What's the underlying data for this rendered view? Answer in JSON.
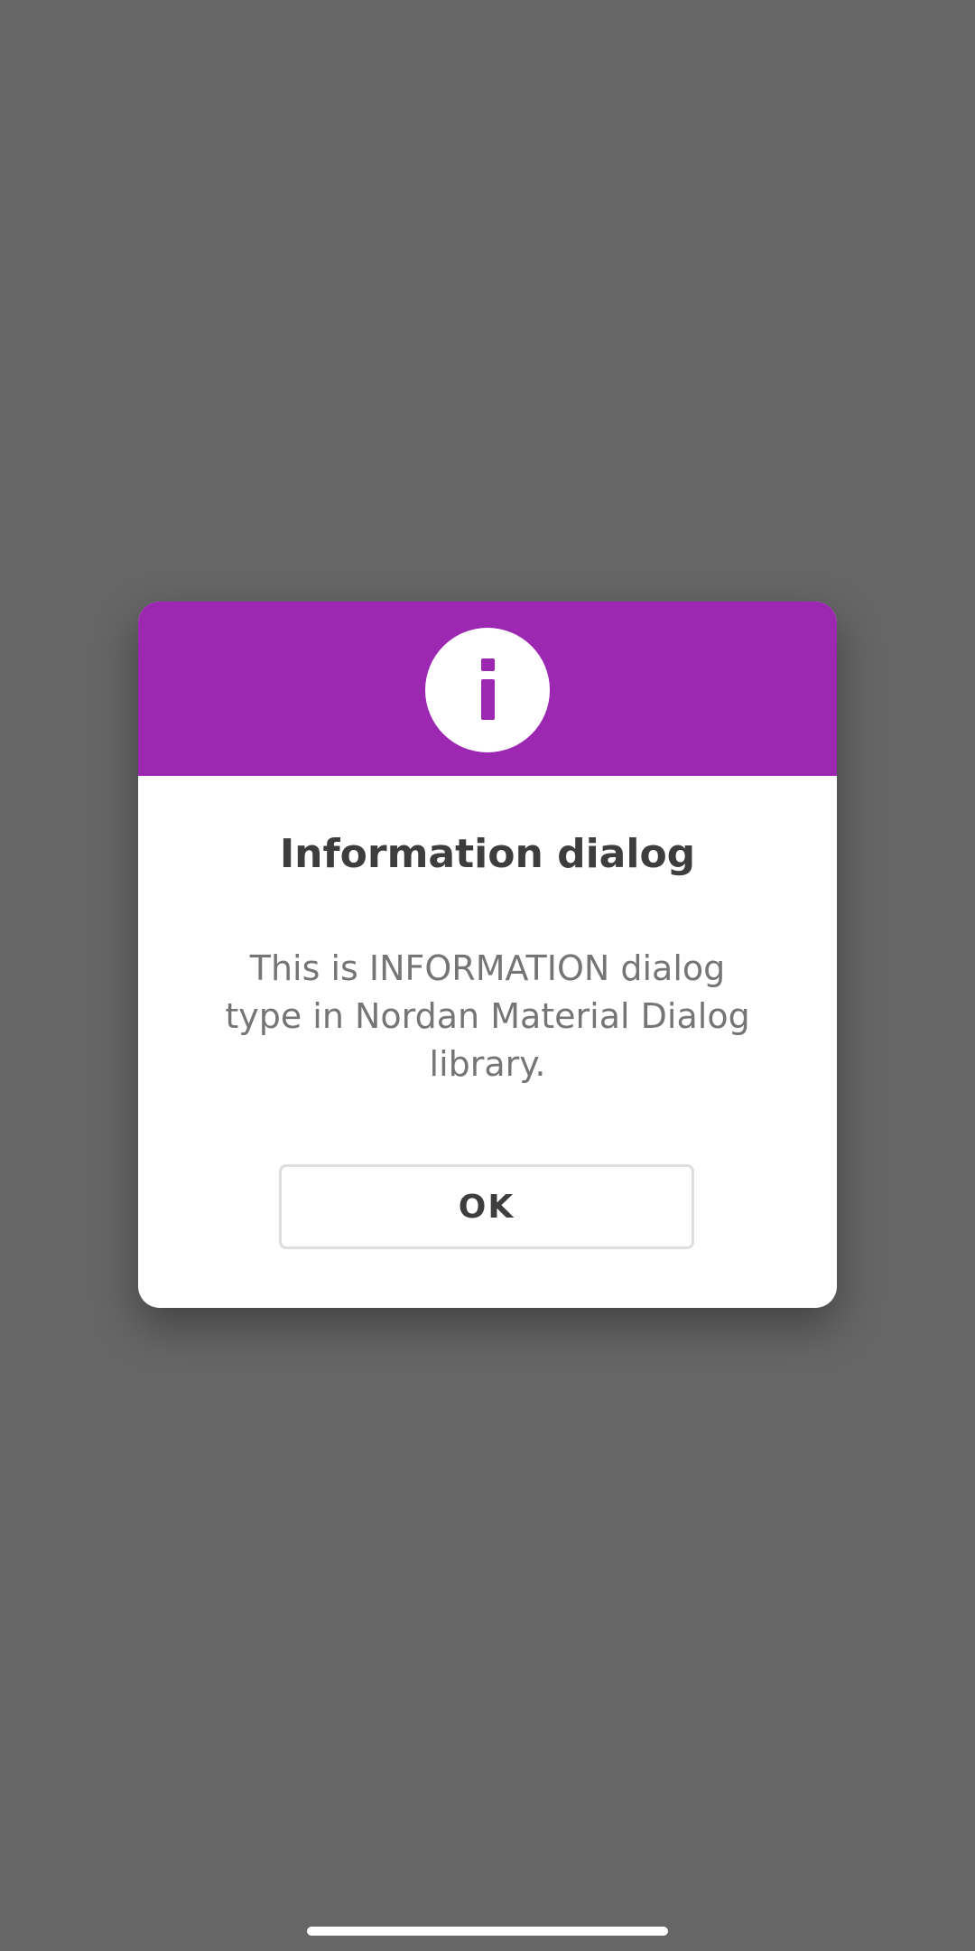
{
  "dialog": {
    "title": "Information dialog",
    "message": "This is INFORMATION dialog type in Nordan Material Dialog library.",
    "ok_label": "OK",
    "icon": "info-icon"
  },
  "colors": {
    "scrim": "#666666",
    "header_accent": "#9c27b0",
    "title_text": "#3d3d3d",
    "message_text": "#757575",
    "button_border": "#dedede"
  }
}
